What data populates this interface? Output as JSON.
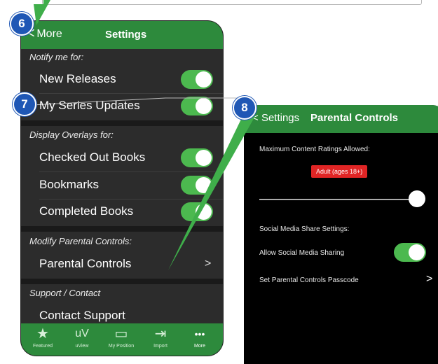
{
  "phone1": {
    "nav": {
      "back_label": "More",
      "title": "Settings"
    },
    "sections": [
      {
        "header": "Notify me for:",
        "rows": [
          "New Releases",
          "My Series Updates"
        ]
      },
      {
        "header": "Display Overlays for:",
        "rows": [
          "Checked Out Books",
          "Bookmarks",
          "Completed Books"
        ]
      },
      {
        "header": "Modify Parental Controls:",
        "rows": [
          "Parental Controls"
        ]
      },
      {
        "header": "Support / Contact",
        "rows": [
          "Contact Support"
        ]
      }
    ],
    "tabs": [
      {
        "label": "Featured",
        "icon": "star-icon",
        "glyph": "★"
      },
      {
        "label": "uView",
        "icon": "uv-icon",
        "glyph": "uV"
      },
      {
        "label": "My Position",
        "icon": "archive-icon",
        "glyph": "▭"
      },
      {
        "label": "Import",
        "icon": "import-icon",
        "glyph": "⇥"
      },
      {
        "label": "More",
        "icon": "more-icon",
        "glyph": "•••"
      }
    ]
  },
  "phone2": {
    "nav": {
      "back_label": "Settings",
      "title": "Parental Controls"
    },
    "max_rating_label": "Maximum Content Ratings Allowed:",
    "rating_value": "Adult (ages 18+)",
    "slider_value": 1.0,
    "social_header": "Social Media Share Settings:",
    "allow_sharing_label": "Allow Social Media Sharing",
    "passcode_label": "Set Parental Controls Passcode"
  },
  "callouts": [
    "6",
    "7",
    "8"
  ],
  "colors": {
    "nav_green": "#2d8a3c",
    "toggle_green": "#4cb94f",
    "badge_blue": "#1f57b5",
    "rating_red": "#e02525"
  }
}
